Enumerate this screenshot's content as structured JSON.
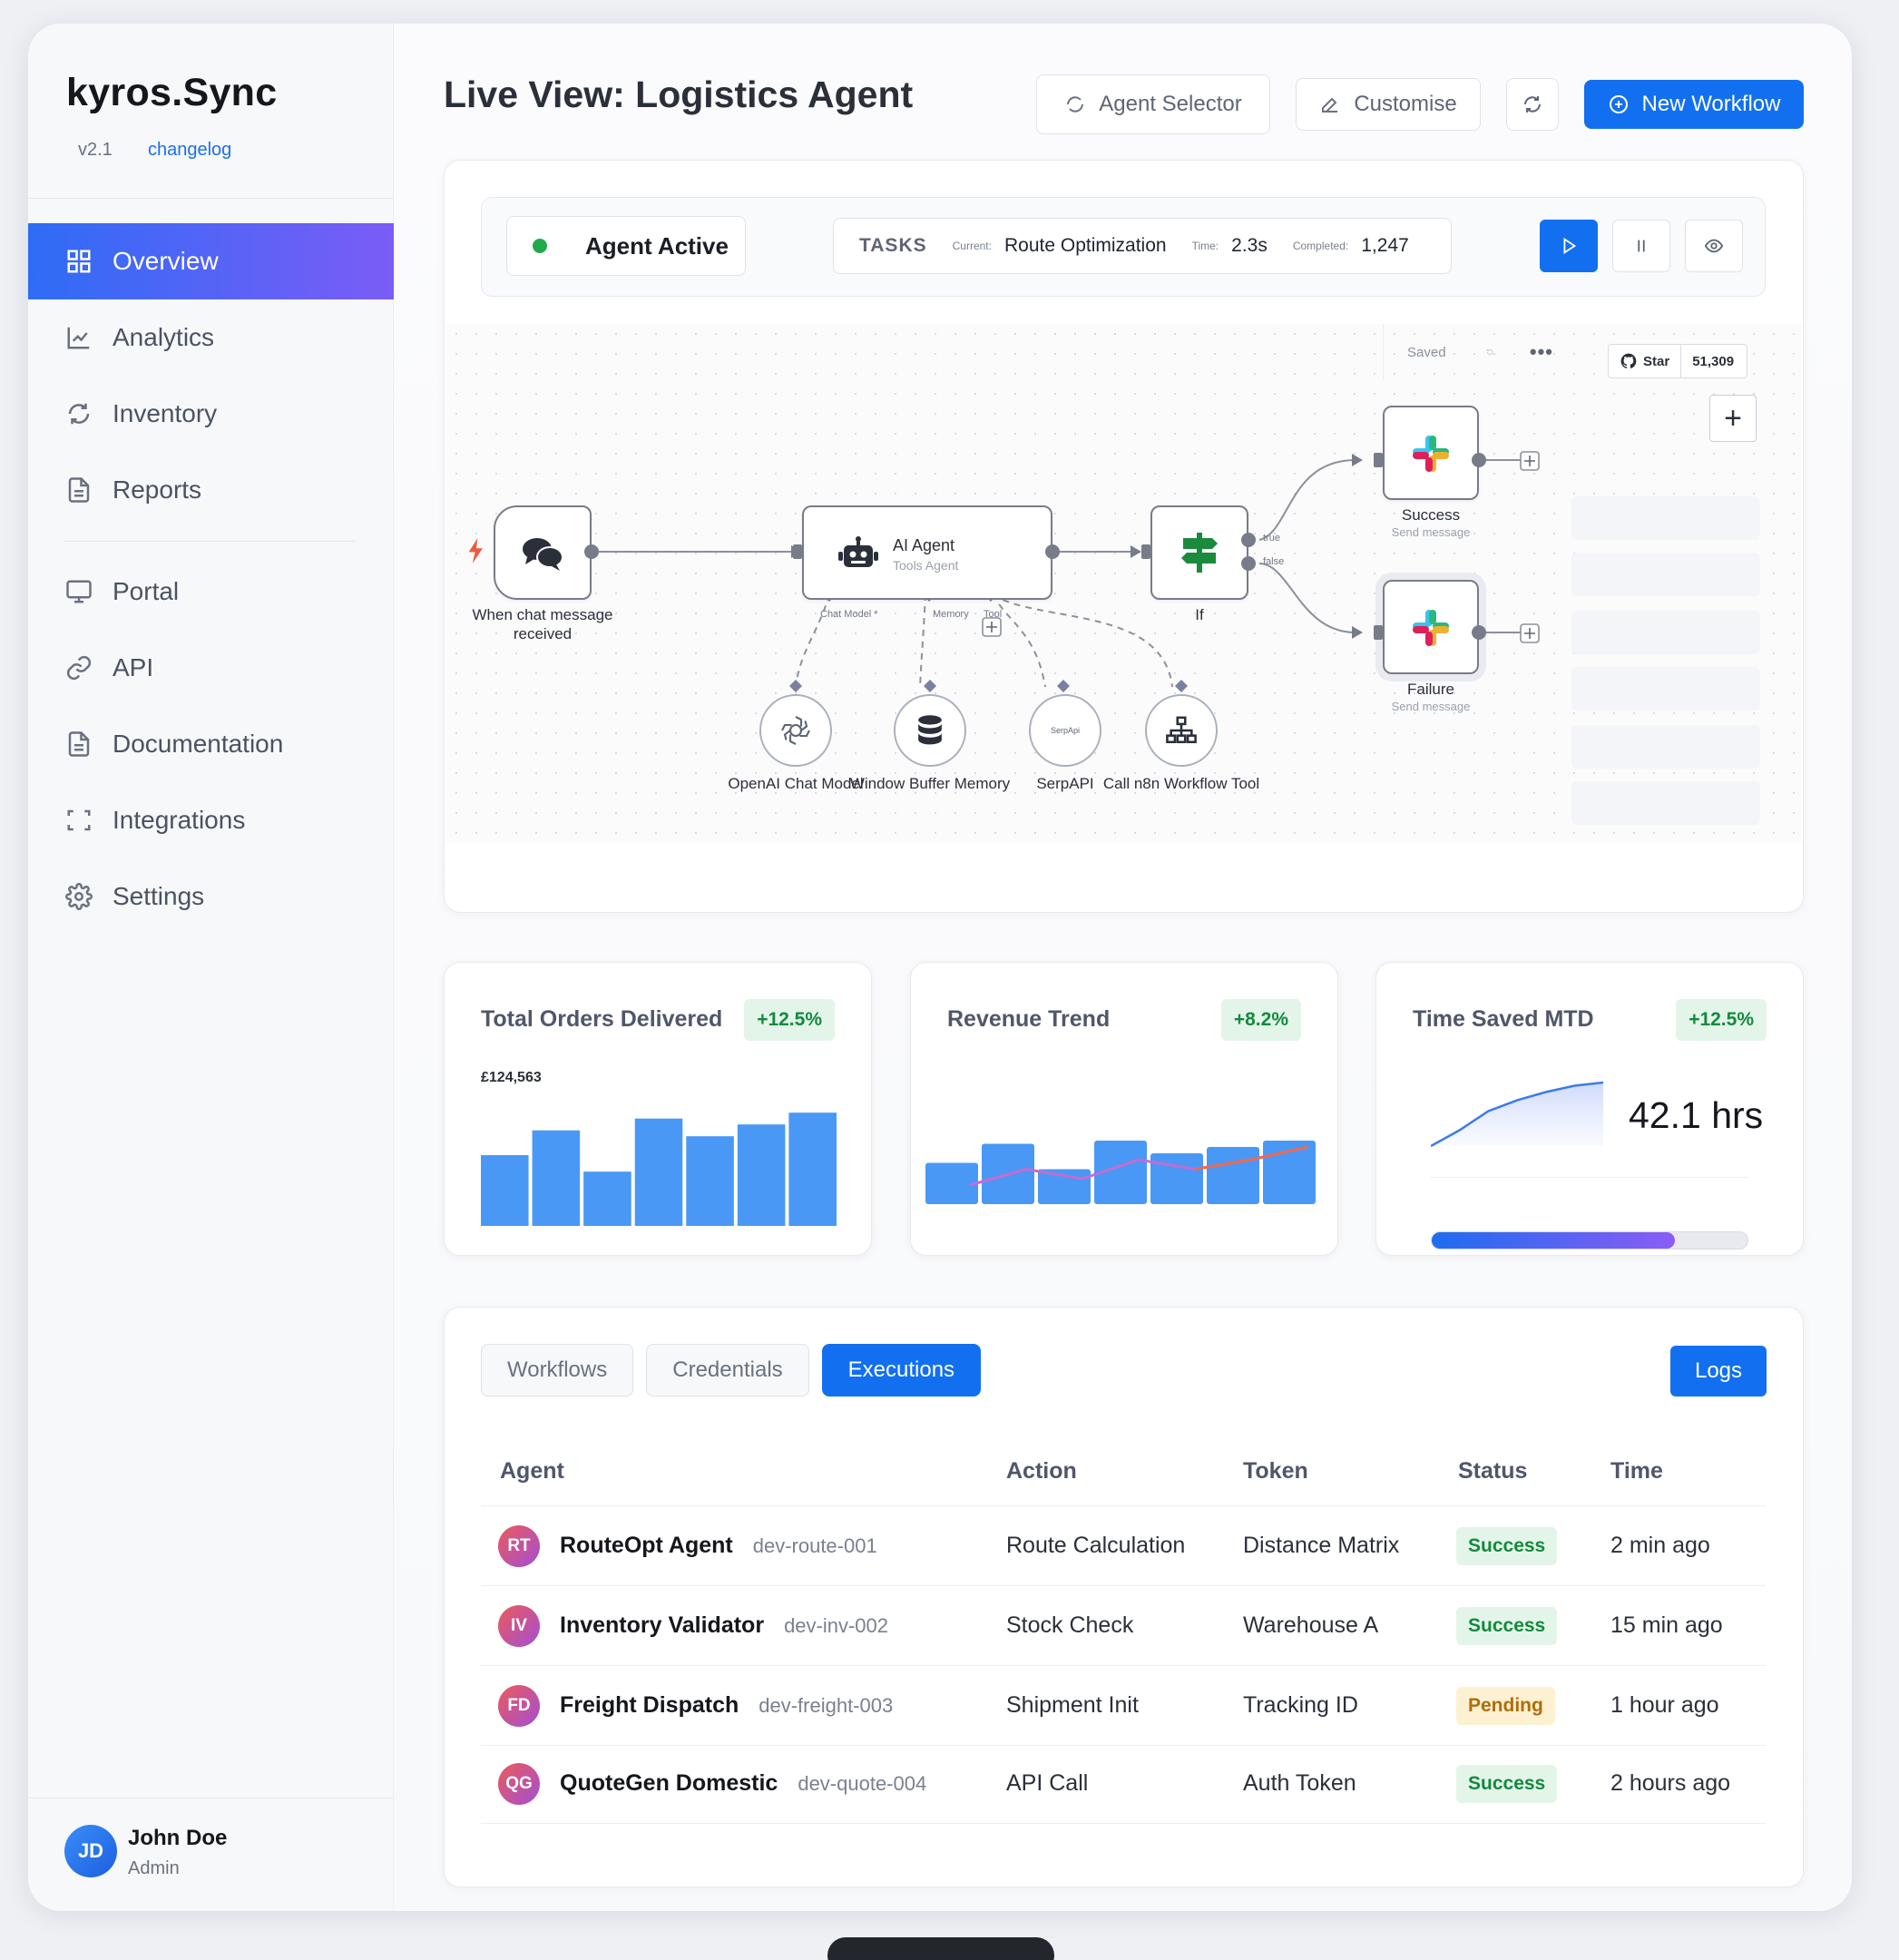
{
  "brand": {
    "name": "kyros.Sync",
    "version": "v2.1",
    "changelog": "changelog"
  },
  "nav": {
    "items": [
      {
        "label": "Overview",
        "icon": "grid-icon",
        "active": true
      },
      {
        "label": "Analytics",
        "icon": "line-chart-icon"
      },
      {
        "label": "Inventory",
        "icon": "sync-icon"
      },
      {
        "label": "Reports",
        "icon": "document-icon"
      },
      {
        "label": "Portal",
        "icon": "monitor-icon"
      },
      {
        "label": "API",
        "icon": "link-icon"
      },
      {
        "label": "Documentation",
        "icon": "document-icon"
      },
      {
        "label": "Integrations",
        "icon": "scan-frame-icon"
      },
      {
        "label": "Settings",
        "icon": "gear-icon"
      }
    ]
  },
  "user": {
    "initials": "JD",
    "name": "John Doe",
    "role": "Admin"
  },
  "header": {
    "title": "Live View: Logistics Agent",
    "agent_selector": "Agent Selector",
    "customise": "Customise",
    "new_workflow": "New Workflow"
  },
  "agent_status": {
    "status": "Agent Active",
    "tasks_label": "TASKS",
    "current_label": "Current:",
    "current_value": "Route Optimization",
    "time_label": "Time:",
    "time_value": "2.3s",
    "completed_label": "Completed:",
    "completed_value": "1,247"
  },
  "workflow": {
    "saved": "Saved",
    "github_star": "Star",
    "github_count": "51,309",
    "trigger": {
      "label": "When chat message received"
    },
    "agent": {
      "title": "AI Agent",
      "subtitle": "Tools Agent"
    },
    "agent_ports": {
      "chat_model": "Chat Model *",
      "memory": "Memory",
      "tool": "Tool"
    },
    "if_node": {
      "label": "If",
      "true_label": "true",
      "false_label": "false"
    },
    "success": {
      "title": "Success",
      "subtitle": "Send message"
    },
    "failure": {
      "title": "Failure",
      "subtitle": "Send message"
    },
    "tools": [
      {
        "label": "OpenAI Chat Model",
        "icon": "openai-icon"
      },
      {
        "label": "Window Buffer Memory",
        "icon": "database-icon"
      },
      {
        "label": "SerpAPI",
        "icon": "serpapi-icon",
        "icon_text": "SerpApi"
      },
      {
        "label": "Call n8n Workflow Tool",
        "icon": "sitemap-icon"
      }
    ]
  },
  "stats": [
    {
      "title": "Total Orders Delivered",
      "badge": "+12.5%",
      "value_label": "£124,563"
    },
    {
      "title": "Revenue Trend",
      "badge": "+8.2%"
    },
    {
      "title": "Time Saved MTD",
      "badge": "+12.5%",
      "value": "42.1 hrs",
      "progress": 0.77
    }
  ],
  "chart_data": [
    {
      "type": "bar",
      "title": "Total Orders Delivered",
      "values": [
        0.6,
        0.81,
        0.46,
        0.91,
        0.76,
        0.86,
        0.96
      ]
    },
    {
      "type": "bar",
      "title": "Revenue Trend",
      "values": [
        0.65,
        0.95,
        0.55,
        1.0,
        0.8,
        0.9,
        1.0
      ],
      "line": [
        0.3,
        0.55,
        0.4,
        0.7,
        0.55,
        0.7,
        0.9
      ]
    },
    {
      "type": "area",
      "title": "Time Saved MTD",
      "values": [
        0.0,
        0.25,
        0.55,
        0.72,
        0.85,
        0.95,
        1.0
      ]
    }
  ],
  "colors": {
    "accent": "#1270f0",
    "active_gradient_start": "#2e6cf5",
    "active_gradient_end": "#7b5cf6",
    "success": "#138a3d",
    "pending": "#b06d0a",
    "bar": "#4a98f5"
  },
  "executions": {
    "tabs": [
      "Workflows",
      "Credentials",
      "Executions"
    ],
    "active_tab": "Executions",
    "logs_button": "Logs",
    "columns": [
      "Agent",
      "Action",
      "Token",
      "Status",
      "Time"
    ],
    "rows": [
      {
        "initials": "RT",
        "agent": "RouteOpt Agent",
        "id": "dev-route-001",
        "action": "Route Calculation",
        "token": "Distance Matrix",
        "status": "Success",
        "time": "2 min ago"
      },
      {
        "initials": "IV",
        "agent": "Inventory Validator",
        "id": "dev-inv-002",
        "action": "Stock Check",
        "token": "Warehouse A",
        "status": "Success",
        "time": "15 min ago"
      },
      {
        "initials": "FD",
        "agent": "Freight Dispatch",
        "id": "dev-freight-003",
        "action": "Shipment Init",
        "token": "Tracking ID",
        "status": "Pending",
        "time": "1 hour ago"
      },
      {
        "initials": "QG",
        "agent": "QuoteGen Domestic",
        "id": "dev-quote-004",
        "action": "API Call",
        "token": "Auth Token",
        "status": "Success",
        "time": "2 hours ago"
      }
    ]
  }
}
